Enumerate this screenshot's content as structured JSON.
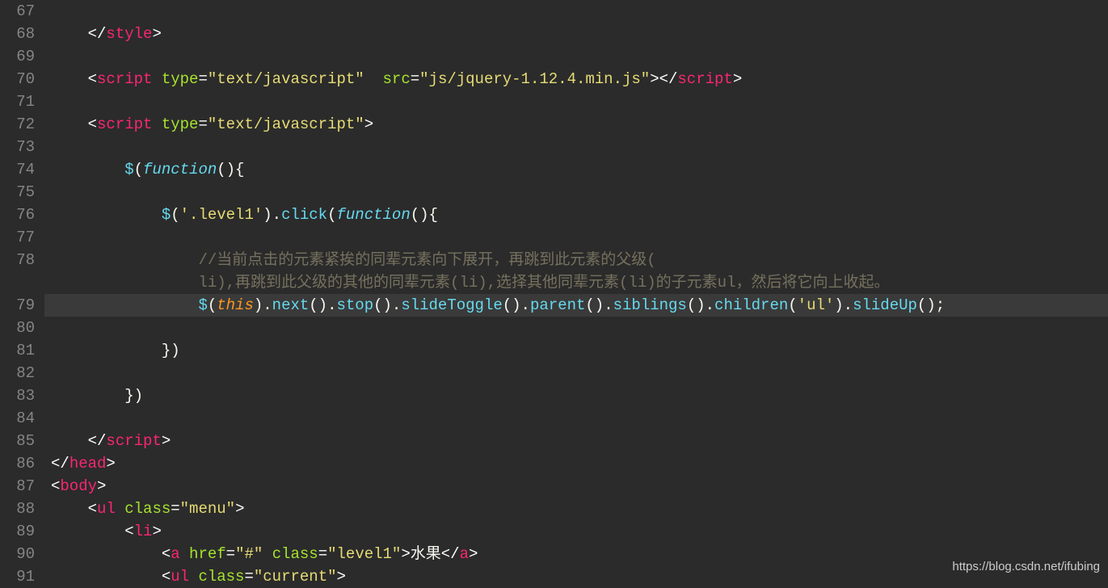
{
  "lines": {
    "67": "",
    "68": "",
    "69": "",
    "70": "",
    "71": "",
    "72": "",
    "73": "",
    "74": "",
    "75": "",
    "76": "",
    "77": "",
    "78a": "//当前点击的元素紧挨的同辈元素向下展开，再跳到此元素的父级(",
    "78b": "li),再跳到此父级的其他的同辈元素(li),选择其他同辈元素(li)的子元素ul，然后将它向上收起。",
    "79": "",
    "80": "",
    "81": "})",
    "82": "",
    "83": "})",
    "84": "",
    "85": "",
    "86": "",
    "87": "",
    "88": "",
    "89": "",
    "90_text": "水果",
    "91": ""
  },
  "tokens": {
    "style": "style",
    "script": "script",
    "head": "head",
    "body": "body",
    "ul": "ul",
    "li": "li",
    "a": "a",
    "type": "type",
    "src": "src",
    "class": "class",
    "href": "href",
    "text_js": "\"text/javascript\"",
    "jquery_src": "\"js/jquery-1.12.4.min.js\"",
    "menu": "\"menu\"",
    "hash": "\"#\"",
    "level1_str": "\"level1\"",
    "current": "\"current\"",
    "level1_sel": "'.level1'",
    "ul_sel": "'ul'",
    "function": "function",
    "this": "this",
    "click": "click",
    "next": "next",
    "stop": "stop",
    "slideToggle": "slideToggle",
    "parent": "parent",
    "siblings": "siblings",
    "children": "children",
    "slideUp": "slideUp",
    "dollar": "$"
  },
  "line_numbers": [
    "67",
    "68",
    "69",
    "70",
    "71",
    "72",
    "73",
    "74",
    "75",
    "76",
    "77",
    "78",
    "",
    "79",
    "80",
    "81",
    "82",
    "83",
    "84",
    "85",
    "86",
    "87",
    "88",
    "89",
    "90",
    "91"
  ],
  "watermark": "https://blog.csdn.net/ifubing"
}
